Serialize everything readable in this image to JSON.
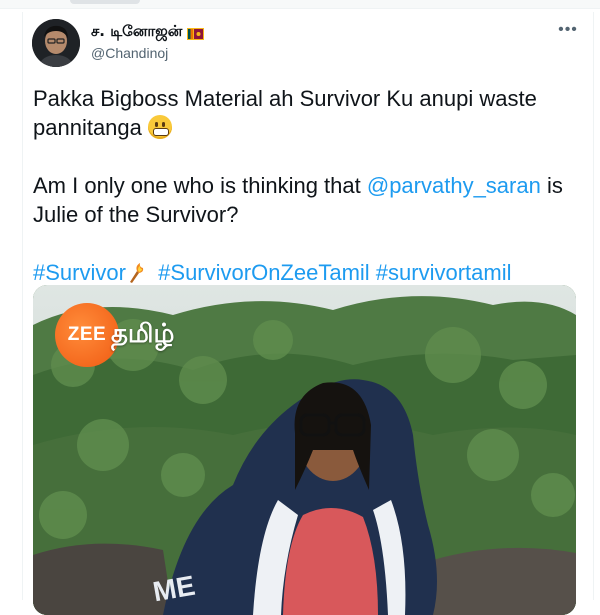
{
  "tweet": {
    "display_name": "ச. டினோஜன்",
    "handle": "@Chandinoj",
    "more_label": "•••",
    "text_line1": "Pakka Bigboss Material ah Survivor Ku anupi waste pannitanga",
    "text_line2_before": "Am I only one who is thinking that",
    "mention": "@parvathy_saran",
    "text_line2_after": "is Julie of the Survivor?",
    "hashtags": [
      "#Survivor",
      "#SurvivorOnZeeTamil",
      "#survivortamil"
    ]
  },
  "media": {
    "logo_text": "ZEE",
    "logo_tamil": "தமிழ்",
    "jacket_text": "ME"
  },
  "colors": {
    "link": "#1d9bf0",
    "text": "#0f1419",
    "secondary": "#536471",
    "logo_orange": "#f05a12"
  },
  "icons": [
    "more-icon",
    "sri-lanka-flag-icon",
    "grimacing-emoji-icon",
    "torch-emoji-icon"
  ]
}
